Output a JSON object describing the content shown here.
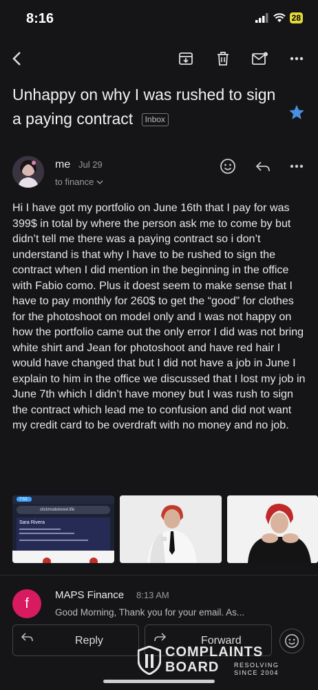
{
  "status_bar": {
    "time": "8:16",
    "battery": "28"
  },
  "email": {
    "subject": "Unhappy on why I was rushed to sign a paying contract",
    "label": "Inbox",
    "sender": {
      "name": "me",
      "date": "Jul 29",
      "to": "to finance"
    },
    "body": "Hi I have got my portfolio on June 16th that I pay for was 399$ in total by where the person ask me to come by but didn’t tell me there was a paying contract so i don’t understand is that why I have to be rushed to sign the contract when I did mention in the beginning in the office with Fabio como. Plus it doest seem to make sense that I have to pay monthly for 260$ to get the “good” for clothes for the photoshoot on model only and I was not happy on how the portfolio came out the only error I did was not bring white shirt and Jean for photoshoot and have red hair I would have changed that but I did not have a job in June I explain to him in the office we discussed that I lost my job in June 7th which I didn’t have money but I was rush to sign the contract which lead me to confusion and did not want my credit card to be overdraft with no money and no job.",
    "attachments": {
      "screenshot": {
        "time": "7:52",
        "url": "clickmodelsreel.life",
        "name": "Sara Rivera"
      }
    }
  },
  "reply_message": {
    "avatar_letter": "f",
    "sender": "MAPS Finance",
    "time": "8:13 AM",
    "snippet": "Good Morning, Thank you for your email. As..."
  },
  "actions": {
    "reply": "Reply",
    "forward": "Forward"
  },
  "watermark": {
    "line1": "COMPLAINTS",
    "line2": "BOARD",
    "small1": "RESOLVING",
    "small2": "SINCE 2004"
  },
  "colors": {
    "background": "#151517",
    "star": "#4a90e2",
    "avatar_f": "#d81b60",
    "battery": "#e4d93a"
  }
}
